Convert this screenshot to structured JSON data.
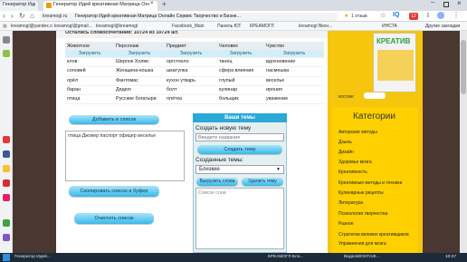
{
  "browser": {
    "tab_active_title": "Генератор Идей креативная Матрица Онлайн Сервис Творчество и Бизне...",
    "tab_other_title": "Генератор Идей кре...",
    "address_host": "kreamogl.ru",
    "address_title": "Генератор Идей креативная Матрица Онлайн Сервис Творчество и Бизне...",
    "star_label": "1 отзыв",
    "badge_count": "12",
    "bookmarks": [
      "kreamogl@yandex.ru",
      "kreamogl@gmail...",
      "kreamogl@kreamogl...",
      "Facebook_Main",
      "Панель ЮТ",
      "КРЕАМОГЛ",
      "kreamogl Вкон...",
      "ИНСТА",
      "Другие закладки"
    ]
  },
  "main": {
    "top_slice_text": "Остались словосочетания: 10724 из 10724 шт.",
    "columns": [
      {
        "header": "Животное",
        "button": "Загрузить",
        "words": [
          "клов",
          "соловей",
          "орёл",
          "баран",
          "птица"
        ]
      },
      {
        "header": "Персонаж",
        "button": "Загрузить",
        "words": [
          "Шерлок Холмс",
          "Женщина-кошка",
          "Фантомас",
          "Дядюл",
          "Русские богатыри"
        ]
      },
      {
        "header": "Предмет",
        "button": "Загрузить",
        "words": [
          "оргстекло",
          "шкатулка",
          "кухон утварь",
          "болт",
          "плётка"
        ]
      },
      {
        "header": "Человек",
        "button": "Загрузить",
        "words": [
          "танец",
          "сфера влияния",
          "глупый",
          "кулинар",
          "больщик"
        ]
      },
      {
        "header": "Чувство",
        "button": "Загрузить",
        "words": [
          "вдохновение",
          "насмешка",
          "веселье",
          "ирония",
          "уважение"
        ]
      }
    ],
    "add_button": "Добавить в список",
    "list_text": "птица Джокер паспорт офицер веселье",
    "copy_button": "Скопировать список в буфер",
    "clear_button": "Очистить список"
  },
  "themes": {
    "heading": "Ваши темы",
    "create_label": "Создать новую тему",
    "input_placeholder": "Введите название",
    "create_button": "Создать тему",
    "created_label": "Созданные темы:",
    "selected_theme": "Близкие",
    "load_button": "Выгрузить слова",
    "delete_button": "Удалить тему",
    "words_area_text": "Список слов"
  },
  "sidebar": {
    "book_title": "КРЕАТИВ",
    "book_caption": "костинг",
    "categories_heading": "Категории",
    "categories": [
      "Авторские методы",
      "Дзынь",
      "Дизайн",
      "Здоровье мозга",
      "Креативность",
      "Креативные методы и техники",
      "Кулинарные рецепты",
      "Литература",
      "Психология творчества",
      "Разное",
      "Стратегии великих креативщиков",
      "Упражнения для мозга"
    ]
  },
  "taskbar": {
    "items": [
      "Генератор Идей...",
      "КРЕАМОГЛ Бло...",
      "ВидеоМОНТАЖ..."
    ],
    "clock": "10:37"
  },
  "colors": {
    "accent_blue": "#39b8ea",
    "sidebar_yellow": "#ffd000",
    "page_brown": "#4a3830"
  }
}
